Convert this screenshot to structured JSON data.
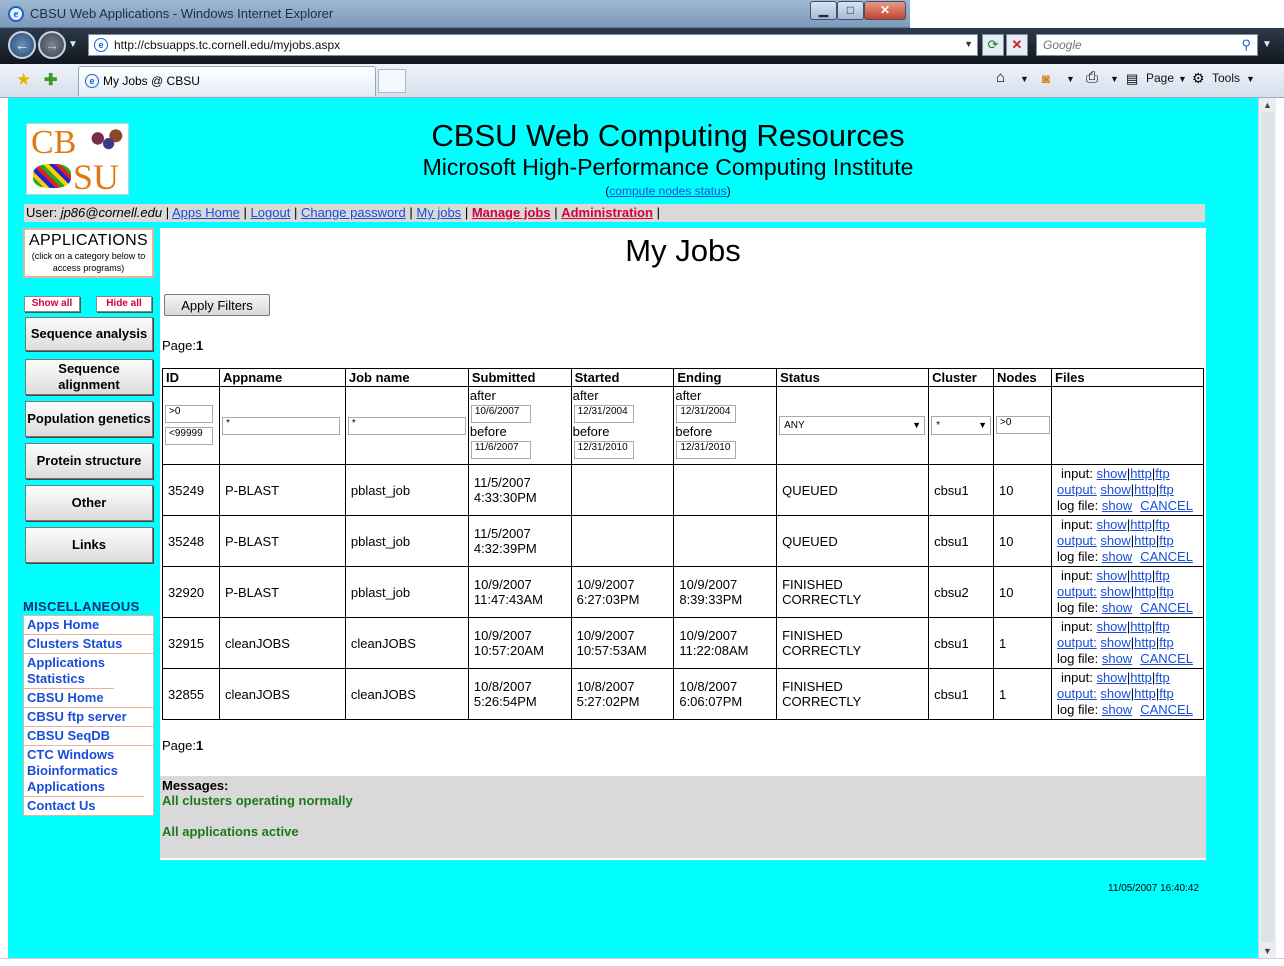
{
  "window": {
    "title": "CBSU Web Applications - Windows Internet Explorer",
    "url": "http://cbsuapps.tc.cornell.edu/myjobs.aspx",
    "search_placeholder": "Google",
    "tab_label": "My Jobs @ CBSU",
    "commands": {
      "page": "Page",
      "tools": "Tools"
    }
  },
  "header": {
    "title": "CBSU Web Computing Resources",
    "subtitle": "Microsoft High-Performance Computing Institute",
    "status_link": "compute nodes status",
    "status_open": "(",
    "status_close": ")"
  },
  "logo": {
    "line1": "CB",
    "line2": "SU"
  },
  "userbar": {
    "user_label": "User:",
    "user": "jp86@cornell.edu",
    "links": [
      "Apps Home",
      "Logout",
      "Change password",
      "My jobs"
    ],
    "red_links": [
      "Manage jobs",
      "Administration"
    ],
    "sep": "|"
  },
  "sidebar": {
    "apps_title": "APPLICATIONS",
    "apps_hint": "(click on a category below to access programs)",
    "show_all": "Show all",
    "hide_all": "Hide all",
    "categories": [
      "Sequence analysis",
      "Sequence alignment",
      "Population genetics",
      "Protein structure",
      "Other",
      "Links"
    ],
    "misc_title": "MISCELLANEOUS",
    "misc_items": [
      "Apps Home",
      "Clusters Status",
      "Applications Statistics",
      "CBSU Home",
      "CBSU ftp server",
      "CBSU SeqDB",
      "CTC Windows Bioinformatics Applications",
      "Contact Us"
    ]
  },
  "main": {
    "title": "My Jobs",
    "apply_filters": "Apply Filters",
    "page_label": "Page:",
    "page_number": "1",
    "columns": [
      "ID",
      "Appname",
      "Job name",
      "Submitted",
      "Started",
      "Ending",
      "Status",
      "Cluster",
      "Nodes",
      "Files"
    ],
    "filters": {
      "id_min": ">0",
      "id_max": "<99999",
      "appname": "*",
      "jobname": "*",
      "after": "after",
      "before": "before",
      "submitted_after": "10/6/2007",
      "submitted_before": "11/6/2007",
      "started_after": "12/31/2004",
      "started_before": "12/31/2010",
      "ending_after": "12/31/2004",
      "ending_before": "12/31/2010",
      "status": "ANY",
      "cluster": "*",
      "nodes": ">0"
    },
    "file_labels": {
      "input": "input:",
      "output": "output:",
      "log": "log file:",
      "show": "show",
      "http": "http",
      "ftp": "ftp",
      "cancel": "CANCEL",
      "pipe": "|"
    },
    "rows": [
      {
        "id": "35249",
        "app": "P-BLAST",
        "job": "pblast_job",
        "sub1": "11/5/2007",
        "sub2": "4:33:30PM",
        "st1": "",
        "st2": "",
        "en1": "",
        "en2": "",
        "status": "QUEUED",
        "cluster": "cbsu1",
        "nodes": "10"
      },
      {
        "id": "35248",
        "app": "P-BLAST",
        "job": "pblast_job",
        "sub1": "11/5/2007",
        "sub2": "4:32:39PM",
        "st1": "",
        "st2": "",
        "en1": "",
        "en2": "",
        "status": "QUEUED",
        "cluster": "cbsu1",
        "nodes": "10"
      },
      {
        "id": "32920",
        "app": "P-BLAST",
        "job": "pblast_job",
        "sub1": "10/9/2007",
        "sub2": "11:47:43AM",
        "st1": "10/9/2007",
        "st2": "6:27:03PM",
        "en1": "10/9/2007",
        "en2": "8:39:33PM",
        "status": "FINISHED CORRECTLY",
        "cluster": "cbsu2",
        "nodes": "10"
      },
      {
        "id": "32915",
        "app": "cleanJOBS",
        "job": "cleanJOBS",
        "sub1": "10/9/2007",
        "sub2": "10:57:20AM",
        "st1": "10/9/2007",
        "st2": "10:57:53AM",
        "en1": "10/9/2007",
        "en2": "11:22:08AM",
        "status": "FINISHED CORRECTLY",
        "cluster": "cbsu1",
        "nodes": "1"
      },
      {
        "id": "32855",
        "app": "cleanJOBS",
        "job": "cleanJOBS",
        "sub1": "10/8/2007",
        "sub2": "5:26:54PM",
        "st1": "10/8/2007",
        "st2": "5:27:02PM",
        "en1": "10/8/2007",
        "en2": "6:06:07PM",
        "status": "FINISHED CORRECTLY",
        "cluster": "cbsu1",
        "nodes": "1"
      }
    ]
  },
  "messages": {
    "title": "Messages:",
    "items": [
      "All clusters operating normally",
      "All applications active"
    ]
  },
  "timestamp": "11/05/2007 16:40:42",
  "colors": {
    "page_bg": "#00ffff",
    "link": "#1a4ed8",
    "red_link": "#d4003a",
    "ok_green": "#1a7a1a"
  }
}
